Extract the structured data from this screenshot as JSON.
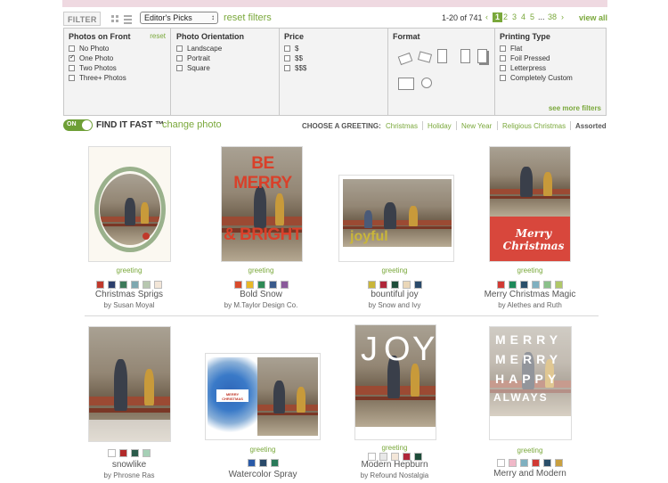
{
  "toolbar": {
    "filter_label": "FILTER",
    "sort_selected": "Editor's Picks",
    "reset_filters": "reset filters",
    "count": "1-20 of 741",
    "pages": [
      "1",
      "2",
      "3",
      "4",
      "5",
      "...",
      "38"
    ],
    "current_page": "1",
    "view_all": "view all"
  },
  "filters": {
    "photos": {
      "title": "Photos on Front",
      "reset": "reset",
      "options": [
        {
          "label": "No Photo",
          "checked": false
        },
        {
          "label": "One Photo",
          "checked": true
        },
        {
          "label": "Two Photos",
          "checked": false
        },
        {
          "label": "Three+ Photos",
          "checked": false
        }
      ]
    },
    "orientation": {
      "title": "Photo Orientation",
      "options": [
        {
          "label": "Landscape",
          "checked": false
        },
        {
          "label": "Portrait",
          "checked": false
        },
        {
          "label": "Square",
          "checked": false
        }
      ]
    },
    "price": {
      "title": "Price",
      "options": [
        {
          "label": "$",
          "checked": false
        },
        {
          "label": "$$",
          "checked": false
        },
        {
          "label": "$$$",
          "checked": false
        }
      ]
    },
    "format": {
      "title": "Format"
    },
    "printing": {
      "title": "Printing Type",
      "options": [
        {
          "label": "Flat",
          "checked": false
        },
        {
          "label": "Foil Pressed",
          "checked": false
        },
        {
          "label": "Letterpress",
          "checked": false
        },
        {
          "label": "Completely Custom",
          "checked": false
        }
      ],
      "see_more": "see more filters"
    }
  },
  "findbar": {
    "toggle_label": "ON",
    "find_label": "FIND IT FAST ™",
    "change_photo": "change photo",
    "choose_label": "CHOOSE A GREETING:",
    "greetings": [
      "Christmas",
      "Holiday",
      "New Year",
      "Religious Christmas",
      "Assorted"
    ],
    "active_greeting": "Assorted"
  },
  "products": [
    {
      "greeting": "greeting",
      "title": "Christmas Sprigs",
      "by": "by Susan Moyal",
      "swatches": [
        "#c0392b",
        "#2c3e6b",
        "#3d7a5a",
        "#7fa8b0",
        "#b7c7b0",
        "#f3e6d8"
      ]
    },
    {
      "greeting": "greeting",
      "title": "Bold Snow",
      "by": "by M.Taylor Design Co.",
      "swatches": [
        "#d94a2b",
        "#e8b828",
        "#2e8a55",
        "#3a5a8a",
        "#8a5a9a"
      ]
    },
    {
      "greeting": "greeting",
      "title": "bountiful joy",
      "by": "by Snow and Ivy",
      "swatches": [
        "#c9b63a",
        "#b0273a",
        "#1e4d3a",
        "#ead7b8",
        "#2a4a6a"
      ]
    },
    {
      "greeting": "greeting",
      "title": "Merry Christmas Magic",
      "by": "by Alethes and Ruth",
      "swatches": [
        "#d13a34",
        "#1e8a5a",
        "#2a4f6a",
        "#7fb0c0",
        "#8ac08a",
        "#b0c868"
      ]
    },
    {
      "greeting": "",
      "title": "snowlike",
      "by": "by Phrosne Ras",
      "swatches": [
        "#ffffff",
        "#b22a2a",
        "#2a5a4a",
        "#a6d0b6"
      ]
    },
    {
      "greeting": "greeting",
      "title": "Watercolor Spray",
      "by": "",
      "swatches": [
        "#2a5aa8",
        "#2a4a6a",
        "#2a7a5a"
      ]
    },
    {
      "greeting": "greeting",
      "title": "Modern Hepburn",
      "by": "by Refound Nostalgia",
      "swatches": [
        "#ffffff",
        "#e8e8e8",
        "#f3e6d8",
        "#b0273a",
        "#1e4d3a"
      ]
    },
    {
      "greeting": "greeting",
      "title": "Merry and Modern",
      "by": "",
      "swatches": [
        "#ffffff",
        "#f0b8c8",
        "#7fb0c0",
        "#d13a34",
        "#2a4f6a",
        "#c9a040"
      ]
    }
  ],
  "card_text": {
    "bold_snow": [
      "BE MERRY",
      "& BRIGHT"
    ],
    "bountiful": "joyful",
    "magic": "Merry Christmas",
    "joy": [
      "J",
      "O",
      "Y"
    ],
    "watercolor": "MERRY CHRISTMAS",
    "modern": [
      "MERRY",
      "MERRY",
      "HAPPY",
      "ALWAYS"
    ]
  }
}
